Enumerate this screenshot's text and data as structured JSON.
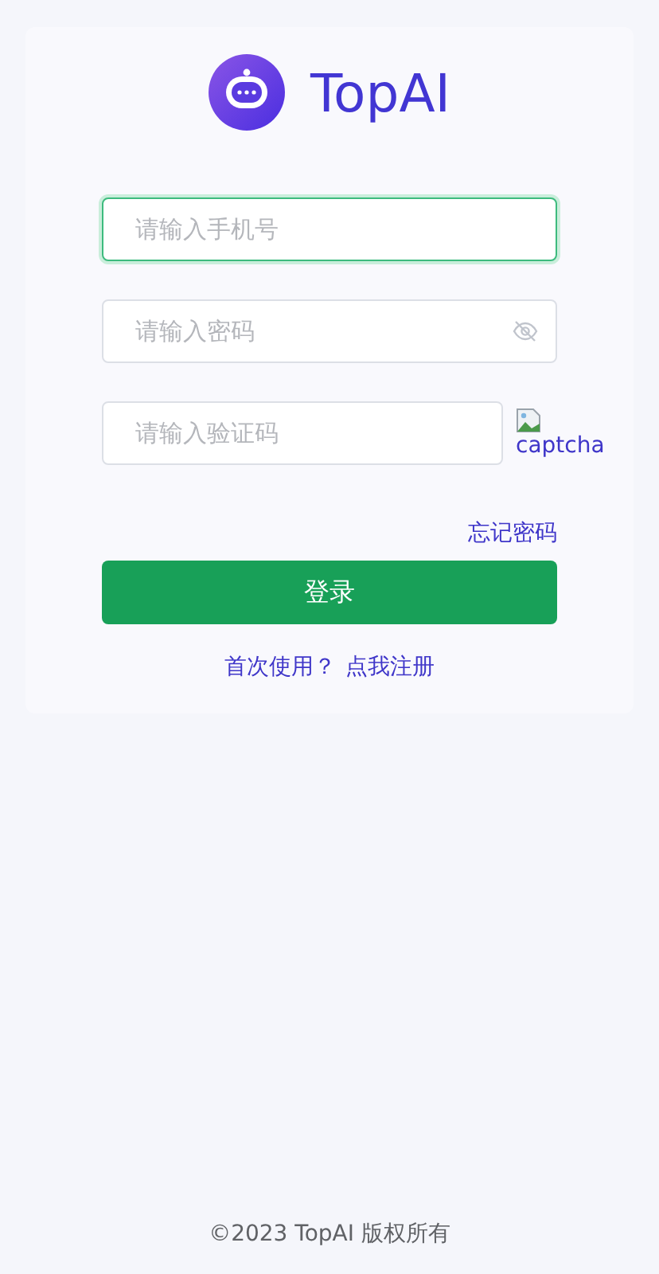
{
  "brand": {
    "name": "TopAI"
  },
  "fields": [
    {
      "kind": "text",
      "placeholder": "请输入手机号",
      "focused": true
    },
    {
      "kind": "password",
      "placeholder": "请输入密码",
      "focused": false
    },
    {
      "kind": "captcha",
      "placeholder": "请输入验证码",
      "focused": false,
      "image_alt": "captcha"
    }
  ],
  "forgot_link": "忘记密码",
  "login_button": "登录",
  "register": {
    "prompt": "首次使用？",
    "link": "点我注册"
  },
  "footer": "©2023 TopAI 版权所有"
}
